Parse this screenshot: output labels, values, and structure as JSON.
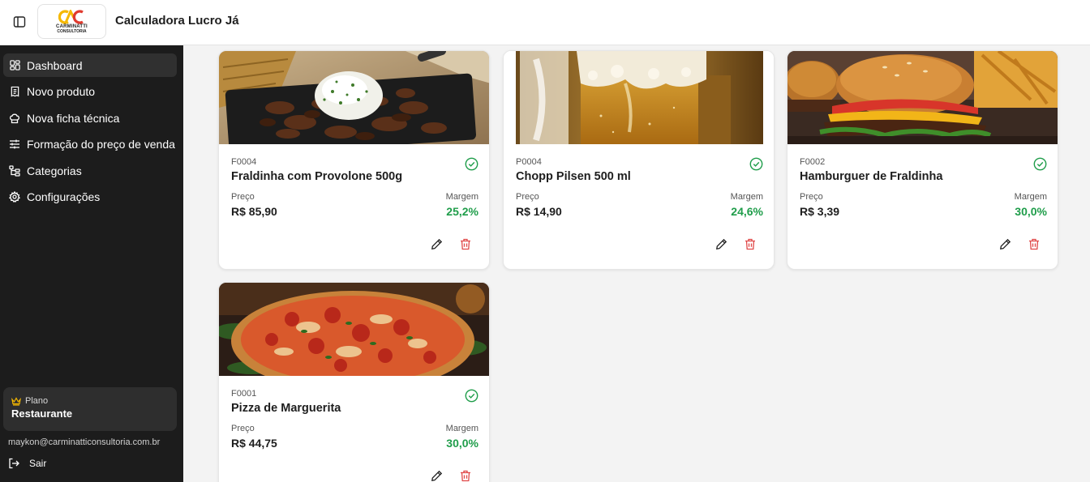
{
  "header": {
    "title": "Calculadora Lucro Já",
    "logo_line1": "CARMINATTI",
    "logo_line2": "CONSULTORIA"
  },
  "sidebar": {
    "items": [
      {
        "label": "Dashboard",
        "icon": "dashboard-icon",
        "active": true
      },
      {
        "label": "Novo produto",
        "icon": "receipt-icon",
        "active": false
      },
      {
        "label": "Nova ficha técnica",
        "icon": "chef-hat-icon",
        "active": false
      },
      {
        "label": "Formação do preço de venda",
        "icon": "sliders-icon",
        "active": false
      },
      {
        "label": "Categorias",
        "icon": "tree-icon",
        "active": false
      },
      {
        "label": "Configurações",
        "icon": "gear-icon",
        "active": false
      }
    ],
    "plan_label": "Plano",
    "plan_name": "Restaurante",
    "user_email": "maykon@carminatticonsultoria.com.br",
    "logout_label": "Sair"
  },
  "products": [
    {
      "code": "F0004",
      "name": "Fraldinha com Provolone 500g",
      "price_label": "Preço",
      "price": "R$ 85,90",
      "margin_label": "Margem",
      "margin": "25,2%"
    },
    {
      "code": "P0004",
      "name": "Chopp Pilsen 500 ml",
      "price_label": "Preço",
      "price": "R$ 14,90",
      "margin_label": "Margem",
      "margin": "24,6%"
    },
    {
      "code": "F0002",
      "name": "Hamburguer de Fraldinha",
      "price_label": "Preço",
      "price": "R$ 3,39",
      "margin_label": "Margem",
      "margin": "30,0%"
    },
    {
      "code": "F0001",
      "name": "Pizza de Marguerita",
      "price_label": "Preço",
      "price": "R$ 44,75",
      "margin_label": "Margem",
      "margin": "30,0%"
    }
  ],
  "colors": {
    "sidebar_bg": "#1c1c1c",
    "margin_green": "#1f9d4a",
    "delete_red": "#e04848",
    "logo_yellow": "#f5b800",
    "logo_red": "#e03a2e"
  }
}
